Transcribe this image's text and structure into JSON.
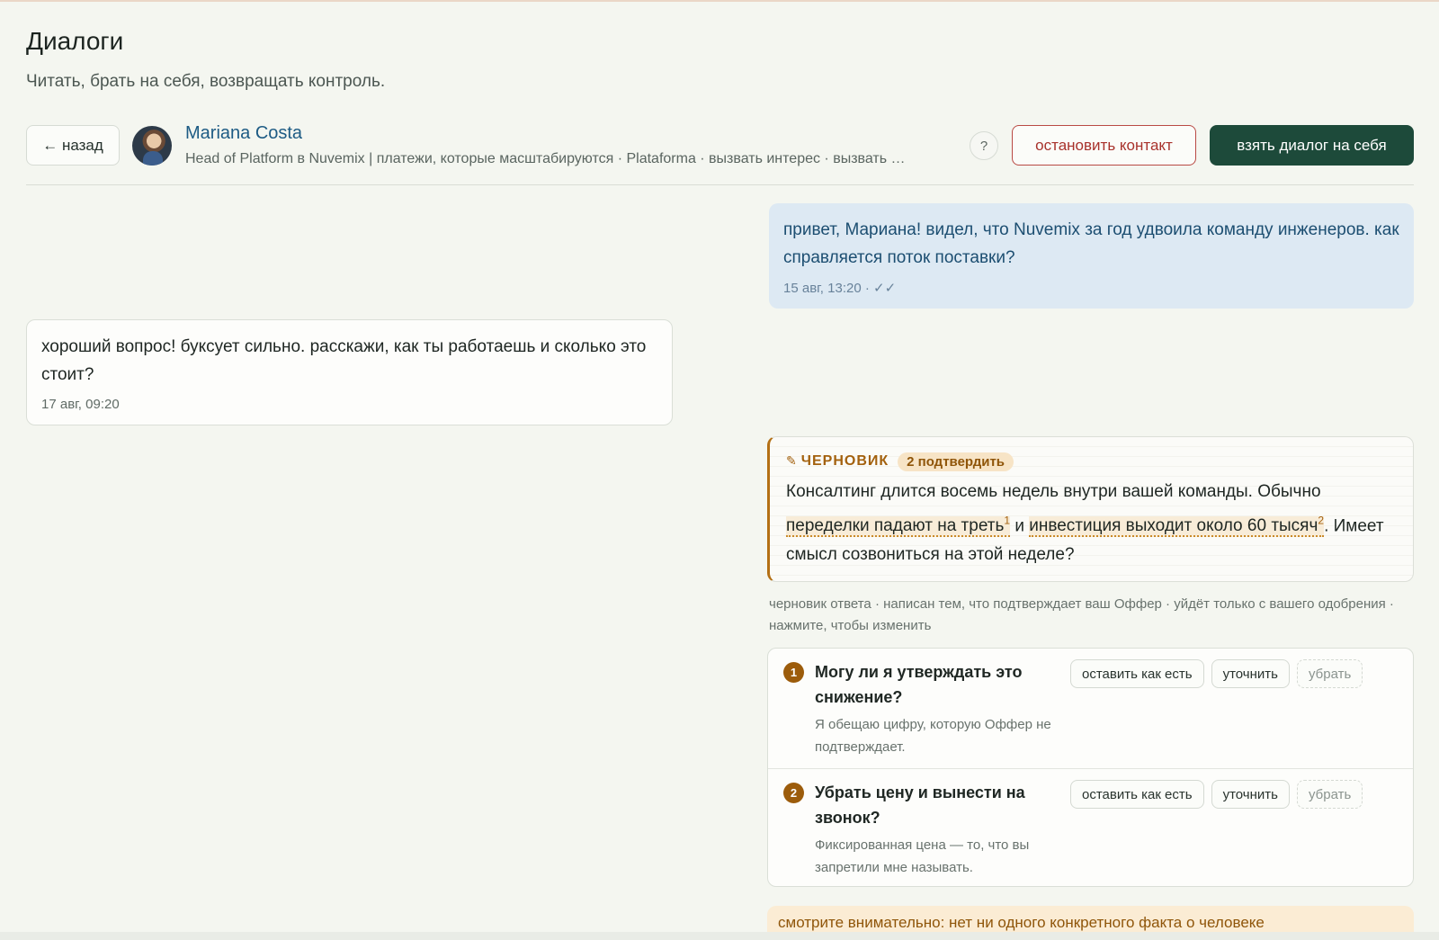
{
  "page": {
    "title": "Диалоги",
    "subtitle": "Читать, брать на себя, возвращать контроль."
  },
  "header": {
    "back_label": "← назад",
    "contact_name": "Mariana Costa",
    "contact_headline": "Head of Platform в Nuvemix | платежи, которые масштабируются · Plataforma · вызвать интерес · вызвать …",
    "help_label": "?",
    "stop_label": "остановить контакт",
    "take_label": "взять диалог на себя",
    "avatar_icon": "person-photo"
  },
  "messages": {
    "outgoing": {
      "text": "привет, Мариана! видел, что Nuvemix за год удвоила команду инженеров. как справляется поток поставки?",
      "meta": "15 авг, 13:20 · ✓✓"
    },
    "incoming": {
      "text": "хороший вопрос! буксует сильно. расскажи, как ты работаешь и сколько это стоит?",
      "meta": "17 авг, 09:20"
    }
  },
  "draft": {
    "label": "ЧЕРНОВИК",
    "pencil_icon": "✎",
    "badge": "2 подтвердить",
    "text_start": "Консалтинг длится восемь недель внутри вашей команды. Обычно ",
    "claim1": "переделки падают на треть",
    "claim1_num": "1",
    "text_mid": " и ",
    "claim2": "инвестиция выходит около 60 тысяч",
    "claim2_num": "2",
    "text_end": ". Имеет смысл созвониться на этой неделе?",
    "note": "черновик ответа · написан тем, что подтверждает ваш Оффер · уйдёт только с вашего одобрения · нажмите, чтобы изменить"
  },
  "questions": [
    {
      "num": "1",
      "title": "Могу ли я утверждать это снижение?",
      "desc": "Я обещаю цифру, которую Оффер не подтверждает.",
      "keep": "оставить как есть",
      "refine": "уточнить",
      "remove": "убрать"
    },
    {
      "num": "2",
      "title": "Убрать цену и вынести на звонок?",
      "desc": "Фиксированная цена — то, что вы запретили мне называть.",
      "keep": "оставить как есть",
      "refine": "уточнить",
      "remove": "убрать"
    }
  ],
  "warning": "смотрите внимательно: нет ни одного конкретного факта о человеке",
  "colors": {
    "accent_dark_green": "#1d4a3a",
    "danger": "#a8322c",
    "draft_amber": "#a3610e",
    "outgoing_bg": "#dde9f3"
  }
}
